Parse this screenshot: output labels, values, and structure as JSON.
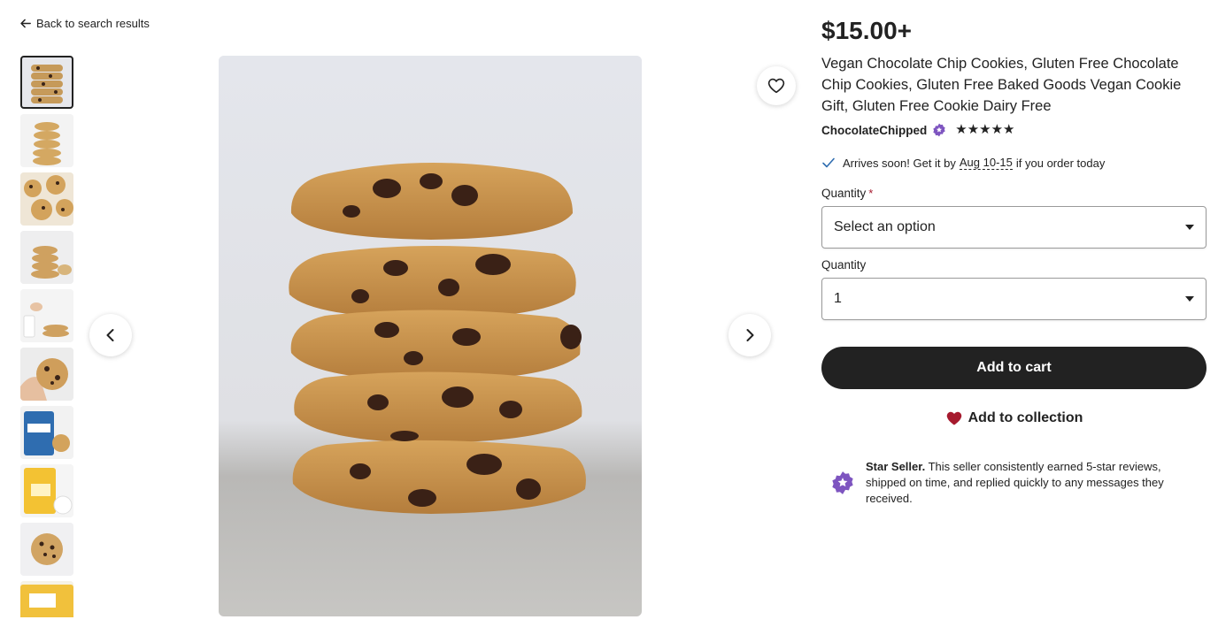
{
  "nav": {
    "back_label": "Back to search results"
  },
  "gallery": {
    "thumbnail_count": 10,
    "active_index": 0
  },
  "listing": {
    "price": "$15.00+",
    "title": "Vegan Chocolate Chip Cookies, Gluten Free Chocolate Chip Cookies, Gluten Free Baked Goods Vegan Cookie Gift, Gluten Free Cookie Dairy Free",
    "shop_name": "ChocolateChipped",
    "rating_stars": "★★★★★",
    "rating": 5
  },
  "shipping": {
    "prefix": "Arrives soon! Get it by",
    "date_range": "Aug 10-15",
    "suffix": "if you order today"
  },
  "options": {
    "quantity_label_1": "Quantity",
    "required_mark": "*",
    "select_1_value": "Select an option",
    "quantity_label_2": "Quantity",
    "select_2_value": "1"
  },
  "actions": {
    "add_to_cart": "Add to cart",
    "add_to_collection": "Add to collection"
  },
  "star_seller": {
    "heading": "Star Seller.",
    "text": "This seller consistently earned 5-star reviews, shipped on time, and replied quickly to any messages they received."
  },
  "colors": {
    "accent_dark": "#222222",
    "star_seller_purple": "#7e55c0",
    "collection_heart": "#a61a2e",
    "check_blue": "#2f6db0"
  }
}
